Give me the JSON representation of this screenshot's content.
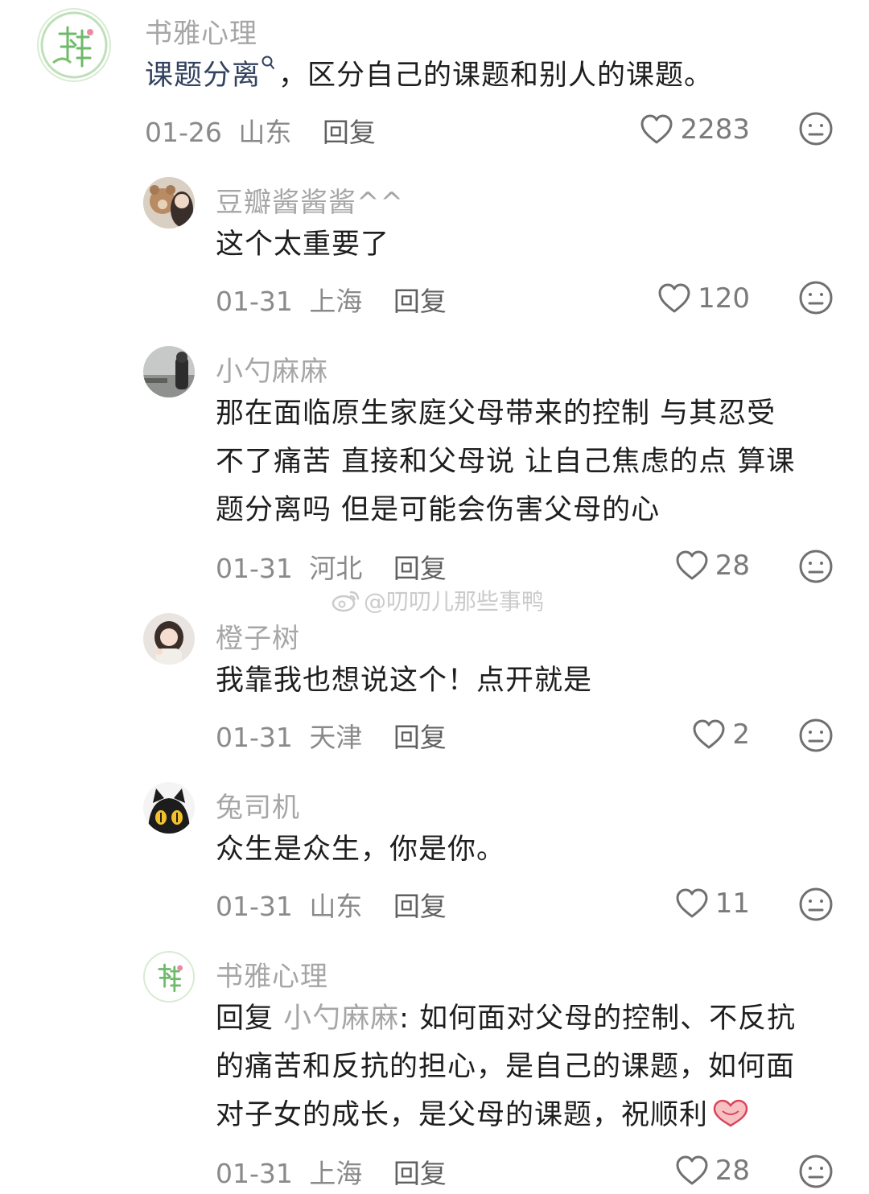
{
  "comments": [
    {
      "username": "书雅心理",
      "keyword": "课题分离",
      "text": "，区分自己的课题和别人的课题。",
      "date": "01-26",
      "location": "山东",
      "reply_label": "回复",
      "likes": "2283"
    },
    {
      "username": "豆瓣酱酱酱^^",
      "text": "这个太重要了",
      "date": "01-31",
      "location": "上海",
      "reply_label": "回复",
      "likes": "120"
    },
    {
      "username": "小勺麻麻",
      "lines": [
        "那在面临原生家庭父母带来的控制 与其忍受",
        "不了痛苦 直接和父母说 让自己焦虑的点 算课",
        "题分离吗 但是可能会伤害父母的心"
      ],
      "date": "01-31",
      "location": "河北",
      "reply_label": "回复",
      "likes": "28"
    },
    {
      "username": "橙子树",
      "text": "我靠我也想说这个！点开就是",
      "date": "01-31",
      "location": "天津",
      "reply_label": "回复",
      "likes": "2"
    },
    {
      "username": "兔司机",
      "text": "众生是众生，你是你。",
      "date": "01-31",
      "location": "山东",
      "reply_label": "回复",
      "likes": "11"
    },
    {
      "username": "书雅心理",
      "reply_prefix": "回复",
      "reply_to": "小勺麻麻",
      "lines": [
        "如何面对父母的控制、不反抗",
        "的痛苦和反抗的担心，是自己的课题，如何面",
        "对子女的成长，是父母的课题，祝顺利"
      ],
      "date": "01-31",
      "location": "上海",
      "reply_label": "回复",
      "likes": "28"
    }
  ],
  "watermark": "@叨叨儿那些事鸭",
  "icons": {
    "like": "heart-outline-icon",
    "dislike": "neutral-face-icon",
    "search": "search-icon",
    "handshake": "heart-hands-emoji"
  },
  "colors": {
    "username": "#a6a6a6",
    "keyword": "#33425f",
    "meta": "#8a8a8a",
    "text": "#1e1e1e",
    "brand_green": "#6fb96a",
    "brand_pink": "#e88aa4"
  }
}
